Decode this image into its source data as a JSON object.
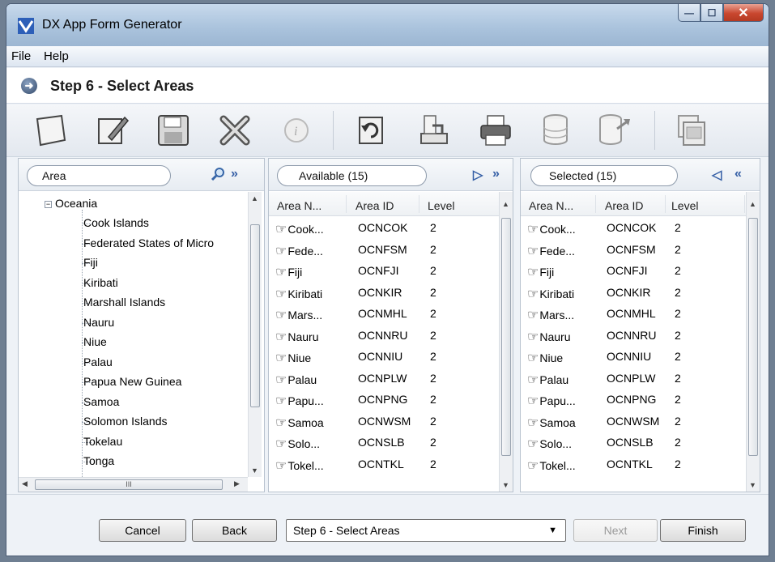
{
  "window": {
    "title": "DX App Form Generator"
  },
  "menu": [
    "File",
    "Help"
  ],
  "step": {
    "title": "Step 6 - Select Areas"
  },
  "toolbar": {
    "icons": [
      "new-form-icon",
      "edit-icon",
      "save-icon",
      "delete-icon",
      "info-icon",
      "refresh-icon",
      "export-icon",
      "print-icon",
      "database-icon",
      "database-export-icon",
      "window-copy-icon"
    ]
  },
  "tree_pane": {
    "search_label": "Area",
    "root": "Oceania",
    "items": [
      "Cook Islands",
      "Federated States of Micro",
      "Fiji",
      "Kiribati",
      "Marshall Islands",
      "Nauru",
      "Niue",
      "Palau",
      "Papua New Guinea",
      "Samoa",
      "Solomon Islands",
      "Tokelau",
      "Tonga"
    ],
    "scroll_glyph": "III"
  },
  "available": {
    "label": "Available (15)",
    "columns": [
      "Area N...",
      "Area ID",
      "Level"
    ],
    "rows": [
      [
        "Cook...",
        "OCNCOK",
        "2"
      ],
      [
        "Fede...",
        "OCNFSM",
        "2"
      ],
      [
        "Fiji",
        "OCNFJI",
        "2"
      ],
      [
        "Kiribati",
        "OCNKIR",
        "2"
      ],
      [
        "Mars...",
        "OCNMHL",
        "2"
      ],
      [
        "Nauru",
        "OCNNRU",
        "2"
      ],
      [
        "Niue",
        "OCNNIU",
        "2"
      ],
      [
        "Palau",
        "OCNPLW",
        "2"
      ],
      [
        "Papu...",
        "OCNPNG",
        "2"
      ],
      [
        "Samoa",
        "OCNWSM",
        "2"
      ],
      [
        "Solo...",
        "OCNSLB",
        "2"
      ],
      [
        "Tokel...",
        "OCNTKL",
        "2"
      ]
    ]
  },
  "selected": {
    "label": "Selected (15)",
    "columns": [
      "Area N...",
      "Area ID",
      "Level"
    ],
    "rows": [
      [
        "Cook...",
        "OCNCOK",
        "2"
      ],
      [
        "Fede...",
        "OCNFSM",
        "2"
      ],
      [
        "Fiji",
        "OCNFJI",
        "2"
      ],
      [
        "Kiribati",
        "OCNKIR",
        "2"
      ],
      [
        "Mars...",
        "OCNMHL",
        "2"
      ],
      [
        "Nauru",
        "OCNNRU",
        "2"
      ],
      [
        "Niue",
        "OCNNIU",
        "2"
      ],
      [
        "Palau",
        "OCNPLW",
        "2"
      ],
      [
        "Papu...",
        "OCNPNG",
        "2"
      ],
      [
        "Samoa",
        "OCNWSM",
        "2"
      ],
      [
        "Solo...",
        "OCNSLB",
        "2"
      ],
      [
        "Tokel...",
        "OCNTKL",
        "2"
      ]
    ]
  },
  "footer": {
    "cancel": "Cancel",
    "back": "Back",
    "step_select": "Step 6 - Select Areas",
    "next": "Next",
    "finish": "Finish"
  },
  "colors": {
    "accent": "#355fa6",
    "title_gradient": "#a9c2dc"
  }
}
